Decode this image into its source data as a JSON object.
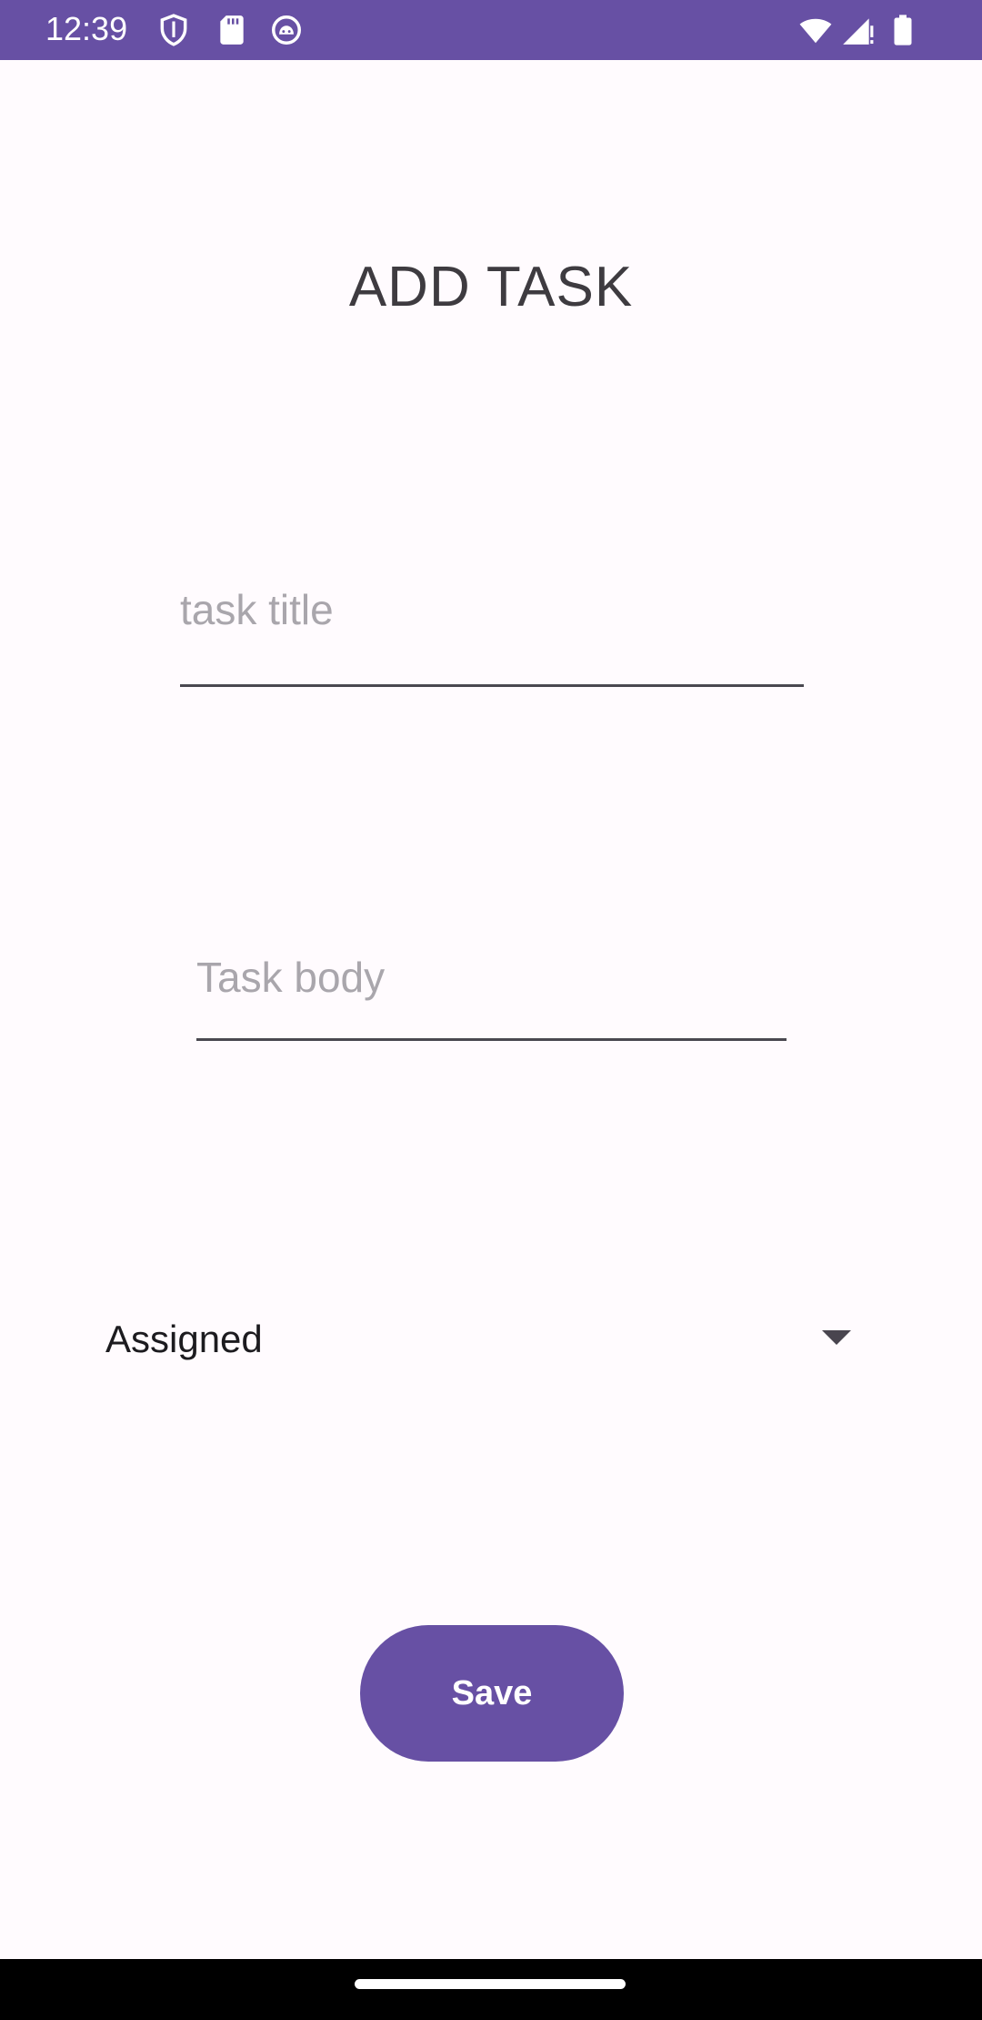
{
  "status_bar": {
    "time": "12:39",
    "left_icons": [
      "shield-icon",
      "sd-card-icon",
      "android-debug-icon"
    ],
    "right_icons": [
      "wifi-icon",
      "signal-icon",
      "battery-icon"
    ],
    "color": "#6750A4"
  },
  "screen": {
    "title": "ADD TASK"
  },
  "form": {
    "title_field": {
      "placeholder": "task title",
      "value": ""
    },
    "body_field": {
      "placeholder": "Task body",
      "value": ""
    },
    "state_spinner": {
      "selected": "Assigned",
      "icon": "dropdown-arrow-icon"
    },
    "save_label": "Save"
  },
  "theme": {
    "accent": "#6750A4",
    "background": "#FFFBFE"
  }
}
